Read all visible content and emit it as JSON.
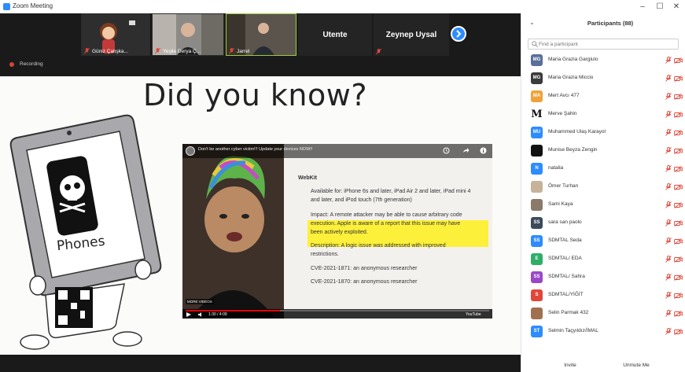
{
  "window": {
    "title": "Zoom Meeting",
    "controls": {
      "minimize": "–",
      "maximize": "☐",
      "close": "✕"
    }
  },
  "gallery": {
    "tiles": [
      {
        "name": "Güniz Çalışka..."
      },
      {
        "name": "Yeşile Derya Ç..."
      },
      {
        "name": "Jarrel"
      },
      {
        "name": "Utente"
      },
      {
        "name": "Zeynep Uysal"
      }
    ]
  },
  "recording": {
    "label": "Recording"
  },
  "slide": {
    "title": "Did you know?",
    "tablet_label": "Phones",
    "video": {
      "title": "Don't be another cyber victim!!! Update your devices NOW!!",
      "heading": "WebKit",
      "available": "Available for: iPhone 6s and later, iPad Air 2 and later, iPad mini 4",
      "available2": "and later, and iPod touch (7th generation)",
      "impact1": "Impact: A remote attacker may be able to cause arbitrary code",
      "impact2": "execution. Apple is aware of a report that this issue may have",
      "impact3": "been actively exploited.",
      "desc1": "Description: A logic issue was addressed with improved",
      "desc2": "restrictions.",
      "cve1": "CVE-2021-1871: an anonymous researcher",
      "cve2": "CVE-2021-1870: an anonymous researcher",
      "more_videos": "MORE VIDEOS",
      "time": "1:30 / 4:09",
      "brand": "YouTube"
    }
  },
  "participants": {
    "title": "Participants (88)",
    "search_placeholder": "Find a participant",
    "list": [
      {
        "initials": "MG",
        "name": "Maria Grazia Gargiulo",
        "color": "#5a6f9a"
      },
      {
        "initials": "MG",
        "name": "Maria Grazia Miccio",
        "color": "#3b3b3b"
      },
      {
        "initials": "MA",
        "name": "Mert Avcı 477",
        "color": "#f0a23a"
      },
      {
        "initials": "M",
        "name": "Merve Şahin",
        "color": "#ffffff"
      },
      {
        "initials": "MU",
        "name": "Muhammed Ulaş Karayol",
        "color": "#2d8cff"
      },
      {
        "initials": "",
        "name": "Munise Beyza Zengin",
        "color": "#111111"
      },
      {
        "initials": "N",
        "name": "natalia",
        "color": "#2d8cff"
      },
      {
        "initials": "",
        "name": "Ömer Turhan",
        "color": "#c7b29a"
      },
      {
        "initials": "",
        "name": "Sami Kaya",
        "color": "#8a7a6a"
      },
      {
        "initials": "SS",
        "name": "sara san paolo",
        "color": "#3b4a5a"
      },
      {
        "initials": "SS",
        "name": "SDMTAL Seda",
        "color": "#2d8cff"
      },
      {
        "initials": "E",
        "name": "SDMTAL/ EDA",
        "color": "#2fae6a"
      },
      {
        "initials": "SS",
        "name": "SDMTAL/ Sahra",
        "color": "#9a47c7"
      },
      {
        "initials": "S",
        "name": "SDMTAL/YİĞİT",
        "color": "#e0473a"
      },
      {
        "initials": "",
        "name": "Selin Parmak 432",
        "color": "#a07050"
      },
      {
        "initials": "ST",
        "name": "Selmin Taçyıldız/İMAL",
        "color": "#2d8cff"
      }
    ],
    "invite_label": "Invite",
    "unmute_label": "Unmute Me"
  },
  "colors": {
    "accent": "#2d8cff",
    "mute_red": "#e0473a",
    "highlight_yellow": "#fdf03a"
  }
}
